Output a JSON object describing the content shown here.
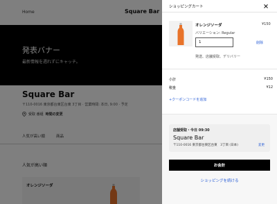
{
  "store_page": {
    "home_link": "Home",
    "logo": "Square Bar",
    "banner": {
      "title": "発表バナー",
      "subtitle": "最新情報を週れずにキャッチ。"
    },
    "store_name": "Square Bar",
    "store_meta": "〒110-0016 東京都台東区台東 3丁目 · 営業時間: 本日, 9:00 · 予定",
    "pickup_text": "受取 番組",
    "pickup_change": "時間の変更",
    "tabs": [
      "人気が高い順",
      "商品"
    ],
    "section_title": "人気が高い順",
    "product_card_name": "オレンジソーダ"
  },
  "cart": {
    "title": "ショッピングカート",
    "item": {
      "name": "オレンジソーダ",
      "price": "¥150",
      "variation": "バリエーション: Regular",
      "quantity": "1",
      "remove_label": "削除",
      "fulfillment": "発送、店舗受取、デリバリー"
    },
    "subtotal_label": "小計",
    "subtotal_value": "¥150",
    "tax_label": "税金",
    "tax_value": "¥12",
    "coupon_label": "+クーポンコードを追加",
    "pickup": {
      "time": "店舗受取・今日 09:30",
      "store": "Square Bar",
      "address": "〒110-0016 東京都台東区台東　3丁目 (日本)",
      "change_label": "変更"
    },
    "checkout_label": "お会計",
    "continue_label": "ショッピングを続ける"
  },
  "colors": {
    "accent_link": "#2b5fd6",
    "checkout_bg": "#000000",
    "soda_orange": "#e8732a"
  }
}
